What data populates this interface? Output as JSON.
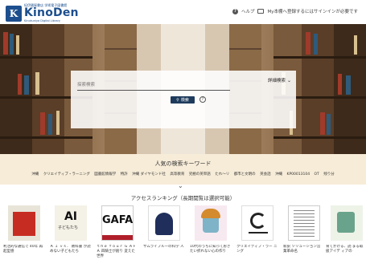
{
  "header": {
    "logo_kicker": "紀伊國屋書店 学術電子図書館",
    "logo_name": "KinoDen",
    "logo_mark": "K",
    "logo_sub": "Kinokuniya Digital Library",
    "help_label": "ヘルプ",
    "mybook_label": "My本棚へ登録するにはサインインが必要です",
    "brand_color": "#1d4f8e"
  },
  "search": {
    "placeholder": "探索検索",
    "advanced_label": "詳細検索",
    "button_label": "検索",
    "help_icon": "?"
  },
  "keywords": {
    "title": "人気の検索キーワード",
    "items": [
      "沖縄",
      "クリエイティブ・ラーニング",
      "図書館情報学",
      "特許",
      "沖縄 ダイヤモンド社",
      "高等教育",
      "究極の英単語",
      "たれ〜リ",
      "都市と文明の",
      "英会話",
      "沖縄",
      "KP00013104",
      "OT",
      "残り分"
    ]
  },
  "ranking": {
    "title": "アクセスランキング（長期閲覧は選択可能）",
    "books": [
      {
        "title": "利活的な通信で 40年 再起型感"
      },
      {
        "title": "Ａ Ｉ ｖｓ． 教科書 が読めない子どもたち"
      },
      {
        "title": "ｔｈｅ ｆｏｕｒ Ｇ ＡＦＡ 四騎士が創り 変えた世界"
      },
      {
        "title": "サムライブルーの科学 人"
      },
      {
        "title": "10代のうちに知っておきたい折れない心の作り"
      },
      {
        "title": "クリエイティブ・ラー ニング"
      },
      {
        "title": "新訳 ソリューション営 業革命名"
      },
      {
        "title": "育てかける、読 まる取扱アイデ ィアの"
      }
    ]
  }
}
